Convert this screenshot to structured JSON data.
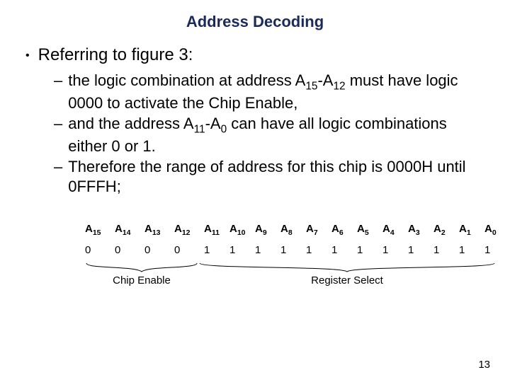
{
  "title": "Address Decoding",
  "bullet": "Referring to figure 3:",
  "sub": [
    "the logic combination at address A<sub>15</sub>-A<sub>12</sub> must have logic 0000 to activate the Chip Enable,",
    "and the address A<sub>11</sub>-A<sub>0</sub> can have all logic combinations either 0 or 1.",
    "Therefore the range of address for this chip is 0000H until 0FFFH;"
  ],
  "chart_data": {
    "type": "table",
    "groups": [
      {
        "label": "Chip Enable",
        "headers": [
          "A15",
          "A14",
          "A13",
          "A12"
        ],
        "values": [
          "0",
          "0",
          "0",
          "0"
        ]
      },
      {
        "label": "Register Select",
        "headers": [
          "A11",
          "A10",
          "A9",
          "A8",
          "A7",
          "A6",
          "A5",
          "A4",
          "A3",
          "A2",
          "A1",
          "A0"
        ],
        "values": [
          "1",
          "1",
          "1",
          "1",
          "1",
          "1",
          "1",
          "1",
          "1",
          "1",
          "1",
          "1"
        ]
      }
    ]
  },
  "page_number": "13"
}
